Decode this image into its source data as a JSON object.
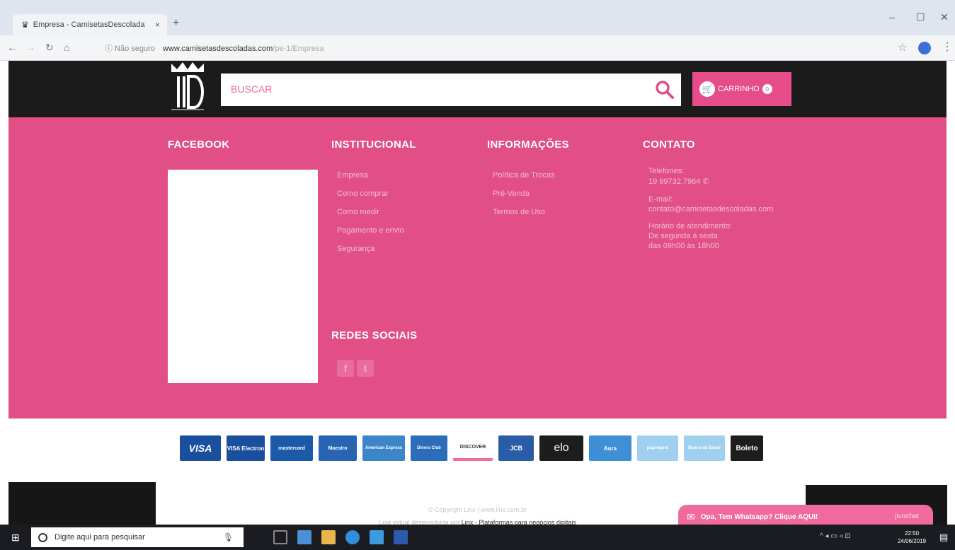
{
  "browser": {
    "tab_title": "Empresa - CamisetasDescolada",
    "tab_close": "×",
    "new_tab": "+",
    "not_secure": "ⓘ Não seguro",
    "url_host": "www.camisetasdescoladas.com",
    "url_path": "/pe-1/Empresa",
    "window_controls": {
      "minimize": "–",
      "maximize": "☐",
      "close": "✕"
    }
  },
  "header": {
    "search_placeholder": "BUSCAR",
    "cart_label": "CARRINHO",
    "cart_count": "0"
  },
  "footer": {
    "facebook_title": "FACEBOOK",
    "institucional": {
      "title": "INSTITUCIONAL",
      "links": [
        "Empresa",
        "Como comprar",
        "Como medir",
        "Pagamento e envio",
        "Segurança"
      ]
    },
    "informacoes": {
      "title": "INFORMAÇÕES",
      "links": [
        "Política de Trocas",
        "Pré-Venda",
        "Termos de Uso"
      ]
    },
    "contato": {
      "title": "CONTATO",
      "phone_label": "Telefones:",
      "phone": "19 99732.7964",
      "email_label": "E-mail:",
      "email": "contato@camisetasdescoladas.com",
      "hours_label": "Horário de atendimento:",
      "hours_days": "De segunda à sexta",
      "hours_time": "das 09h00 às 18h00"
    },
    "redes_sociais_title": "REDES SOCIAIS",
    "social": [
      "f",
      "t"
    ]
  },
  "payments": [
    "VISA",
    "VISA Electron",
    "mastercard",
    "Maestro",
    "American Express",
    "Diners Club",
    "DISCOVER",
    "JCB",
    "elo",
    "Aura",
    "pagseguro",
    "Banco do Brasil",
    "Boleto"
  ],
  "bottom": {
    "copyright": "© Copyright Linx | www.linx.com.br",
    "developed_prefix": "Loja virtual desenvolvida por",
    "developed_company": "Linx - Plataformas para negócios digitais",
    "whatsapp": "Opa, Tem Whatsapp? Clique AQUI!",
    "chat_brand": "jivochat"
  },
  "taskbar": {
    "search_placeholder": "Digite aqui para pesquisar",
    "time": "22:50",
    "date": "24/06/2019"
  },
  "colors": {
    "brand_pink": "#e14f86",
    "header_dark": "#1b1b1b"
  }
}
